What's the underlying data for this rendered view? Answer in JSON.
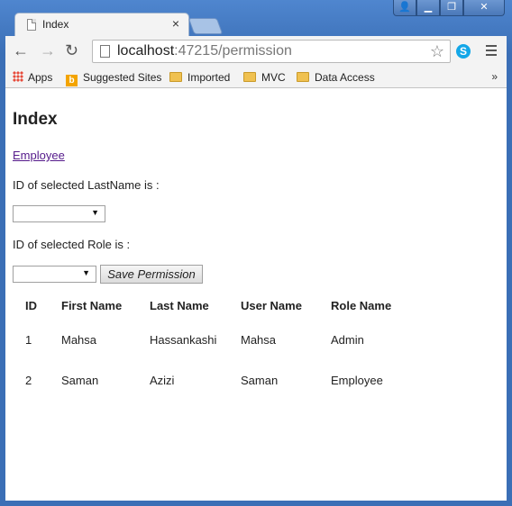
{
  "tab": {
    "title": "Index",
    "close": "×"
  },
  "window": {
    "minimize": "▁",
    "maximize": "❐",
    "close": "✕"
  },
  "address": {
    "host": "localhost",
    "rest": ":47215/permission"
  },
  "bookmarks": [
    "Apps",
    "Suggested Sites",
    "Imported",
    "MVC",
    "Data Access"
  ],
  "overflow": "»",
  "page": {
    "heading": "Index",
    "link": "Employee",
    "label_lastname": "ID of selected LastName is :",
    "label_role": "ID of selected Role is :",
    "save_button": "Save Permission"
  },
  "table": {
    "headers": [
      "ID",
      "First Name",
      "Last Name",
      "User Name",
      "Role Name"
    ],
    "rows": [
      [
        "1",
        "Mahsa",
        "Hassankashi",
        "Mahsa",
        "Admin"
      ],
      [
        "2",
        "Saman",
        "Azizi",
        "Saman",
        "Employee"
      ]
    ]
  },
  "icons": {
    "back": "back-arrow-icon",
    "forward": "forward-arrow-icon",
    "reload": "reload-icon",
    "star": "star-icon",
    "skype": "skype-icon",
    "menu": "menu-icon"
  },
  "colors": {
    "frame": "#4a7dc3",
    "link": "#551a8b",
    "skype": "#13a7e8"
  }
}
